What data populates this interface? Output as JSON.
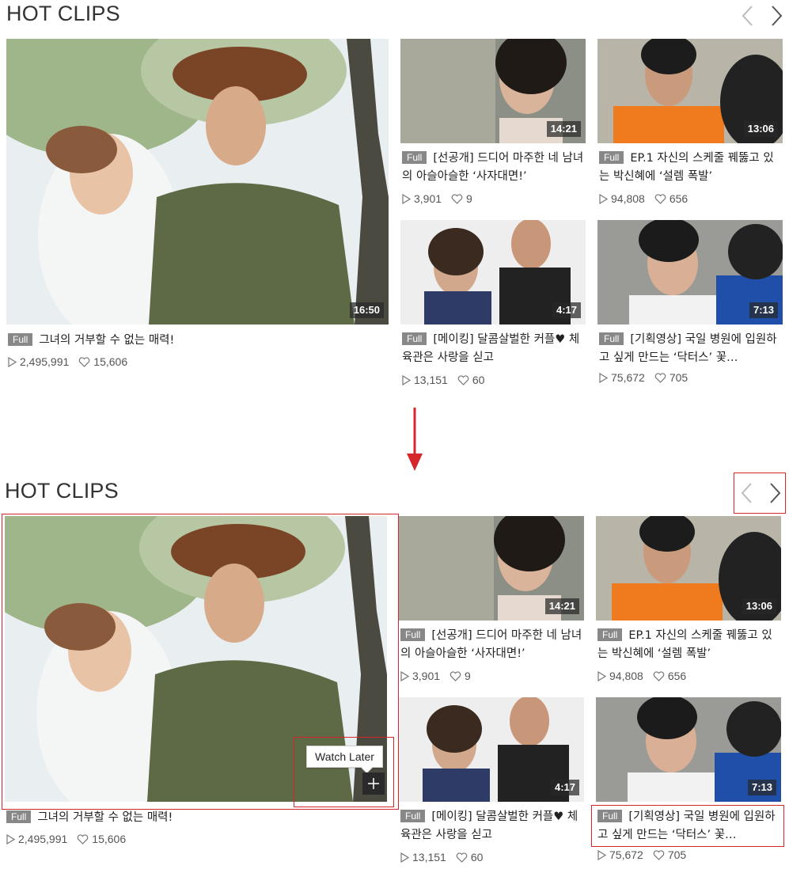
{
  "section_title": "HOT CLIPS",
  "badge": "Full",
  "tooltip": "Watch Later",
  "clips": [
    {
      "title": "그녀의 거부할 수 없는 매력!",
      "duration": "16:50",
      "plays": "2,495,991",
      "likes": "15,606"
    },
    {
      "title": "[선공개] 드디어 마주한 네 남녀의 아슬아슬한 ‘사자대면!’",
      "duration": "14:21",
      "plays": "3,901",
      "likes": "9"
    },
    {
      "title": "EP.1 자신의 스케줄 꿰뚫고 있는 박신혜에 ‘설렘 폭발’",
      "duration": "13:06",
      "plays": "94,808",
      "likes": "656"
    },
    {
      "title": "[메이킹] 달콤살벌한 커플♥ 체육관은 사랑을 싣고",
      "duration": "4:17",
      "plays": "13,151",
      "likes": "60"
    },
    {
      "title": "[기획영상] 국일 병원에 입원하고 싶게 만드는 ‘닥터스’ 꽃…",
      "duration": "7:13",
      "plays": "75,672",
      "likes": "705"
    }
  ],
  "colors": {
    "highlight": "#d4262b",
    "badge": "#888888"
  }
}
